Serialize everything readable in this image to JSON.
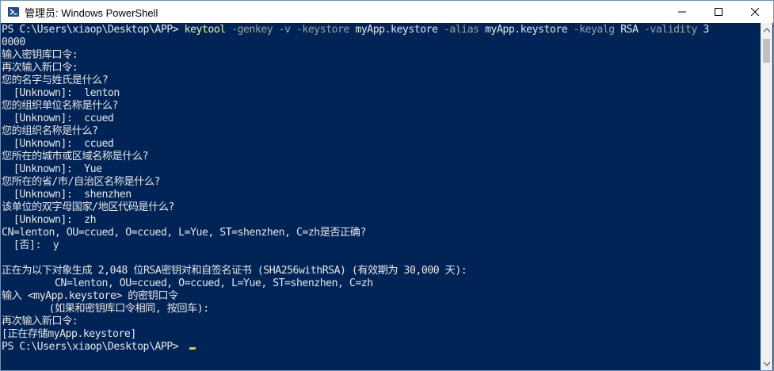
{
  "window": {
    "title": "管理员: Windows PowerShell",
    "icons": {
      "app": "powershell-icon",
      "minimize": "minimize-icon",
      "maximize": "maximize-icon",
      "close": "close-icon"
    }
  },
  "console": {
    "command": {
      "prompt": "PS C:\\Users\\xiaop\\Desktop\\APP> ",
      "tool": "keytool",
      "p1": " -genkey -v -keystore ",
      "v1": "myApp.keystore",
      "p2": " -alias ",
      "v2": "myApp.keystore",
      "p3": " -keyalg ",
      "v3": "RSA",
      "p4": " -validity ",
      "v4": "3",
      "wrap": "0000"
    },
    "lines": [
      "输入密钥库口令:",
      "再次输入新口令:",
      "您的名字与姓氏是什么?",
      "  [Unknown]:  lenton",
      "您的组织单位名称是什么?",
      "  [Unknown]:  ccued",
      "您的组织名称是什么?",
      "  [Unknown]:  ccued",
      "您所在的城市或区域名称是什么?",
      "  [Unknown]:  Yue",
      "您所在的省/市/自治区名称是什么?",
      "  [Unknown]:  shenzhen",
      "该单位的双字母国家/地区代码是什么?",
      "  [Unknown]:  zh",
      "CN=lenton, OU=ccued, O=ccued, L=Yue, ST=shenzhen, C=zh是否正确?",
      "  [否]:  y",
      "",
      "正在为以下对象生成 2,048 位RSA密钥对和自签名证书 (SHA256withRSA) (有效期为 30,000 天):",
      "         CN=lenton, OU=ccued, O=ccued, L=Yue, ST=shenzhen, C=zh",
      "输入 <myApp.keystore> 的密钥口令",
      "        (如果和密钥库口令相同, 按回车):",
      "再次输入新口令:",
      "[正在存储myApp.keystore]"
    ],
    "final_prompt": "PS C:\\Users\\xiaop\\Desktop\\APP> "
  }
}
